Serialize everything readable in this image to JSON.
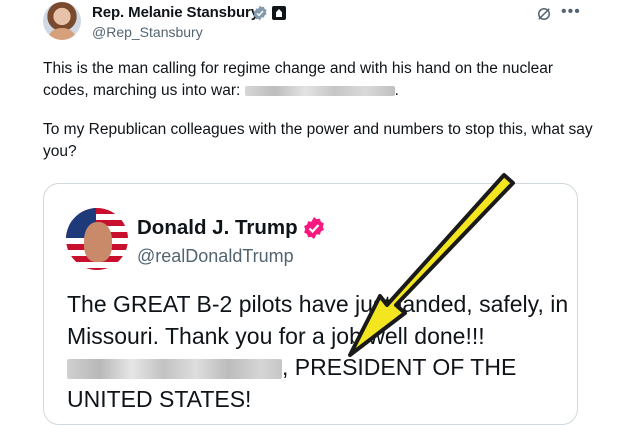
{
  "tweet": {
    "author_name": "Rep. Melanie Stansbury",
    "author_handle": "@Rep_Stansbury",
    "paragraph1": "This is the man calling for regime change and with his hand on the nuclear codes, marching us into war:",
    "paragraph1_end": ".",
    "paragraph2": "To my Republican colleagues with the power and numbers to stop this, what say you?",
    "icons": [
      "verified-badge-icon",
      "government-badge-icon",
      "grok-icon",
      "more-icon"
    ]
  },
  "quoted_post": {
    "author_name": "Donald J. Trump",
    "author_handle": "@realDonaldTrump",
    "text_part1": "The GREAT B-2 pilots have just landed, safely, in Missouri. Thank you for a job well done!!!",
    "text_part2": ", PRESIDENT OF THE UNITED STATES!"
  },
  "colors": {
    "text": "#0f1419",
    "secondary_text": "#536471",
    "verified_gray": "#829aab",
    "verified_red": "#f91880",
    "card_border": "#cfd9de",
    "arrow": "#f3e520"
  }
}
